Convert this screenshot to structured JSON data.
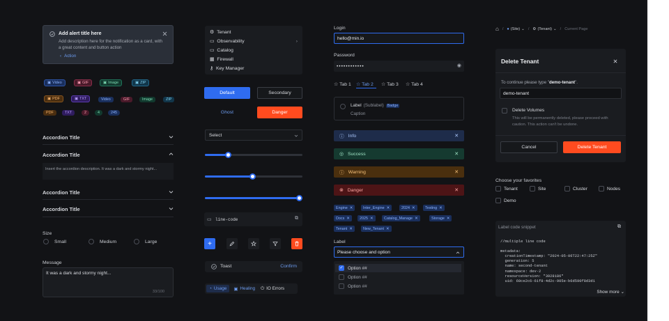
{
  "alert": {
    "title": "Add alert title here",
    "description": "Add description here for the notification as a card, with a great content and button action",
    "action": "Action"
  },
  "badges_row1": [
    "Video",
    "GIF",
    "Image",
    "ZIP"
  ],
  "badges_row2": [
    "PDF",
    "TXT",
    "Video",
    "GIF",
    "Image",
    "ZIP"
  ],
  "badges_row3": [
    "PDF",
    "TXT",
    "2",
    "4",
    "245"
  ],
  "accordion": {
    "items": [
      "Accordion Title",
      "Accordion Title",
      "Accordion Title",
      "Accordion Title"
    ],
    "body": "Insert the accordion description. It was a dark and stormy night..."
  },
  "size": {
    "label": "Size",
    "options": [
      "Small",
      "Medium",
      "Large"
    ]
  },
  "message": {
    "label": "Message",
    "value": "It was a dark and stormy night...",
    "counter": "33/100"
  },
  "menu": {
    "items": [
      "Tenant",
      "Observability",
      "Catalog",
      "Firewall",
      "Key Manager"
    ]
  },
  "buttons": {
    "default": "Default",
    "secondary": "Secondary",
    "ghost": "Ghost",
    "danger": "Danger"
  },
  "select": {
    "value": "Select"
  },
  "sliders": [
    0.24,
    0.49,
    0.97
  ],
  "code_field": {
    "value": "line-code"
  },
  "toast": {
    "text": "Toast",
    "action": "Confirm"
  },
  "tabs_bottom": [
    "Usage",
    "Healing",
    "IO Errors"
  ],
  "login": {
    "label": "Login",
    "value": "hello@min.io",
    "password_label": "Password",
    "password_value": "••••••••••••"
  },
  "tabs": [
    "Tab 1",
    "Tab 2",
    "Tab 3",
    "Tab 4"
  ],
  "checkbox_card": {
    "label": "Label",
    "sublabel": "(Sublabel)",
    "badge": "Badge",
    "caption": "Caption"
  },
  "notifications": [
    {
      "text": "Info",
      "color": "#2f6cf0"
    },
    {
      "text": "Success",
      "color": "#21a36b"
    },
    {
      "text": "Warning",
      "color": "#f0961c"
    },
    {
      "text": "Danger",
      "color": "#e5393b"
    }
  ],
  "chips": [
    "Engine",
    "Inter_Engine",
    "2024",
    "Testing",
    "Docs",
    "2025",
    "Catalog_Manage",
    "Storage",
    "Tenant",
    "New_Tenant"
  ],
  "dropdown": {
    "label": "Label",
    "placeholder": "Please choose and option",
    "options": [
      "Option ##",
      "Option ##",
      "Option ##"
    ]
  },
  "breadcrumb": {
    "items": [
      "(Site)",
      "(Tenant)",
      "Current Page"
    ]
  },
  "modal": {
    "title": "Delete Tenant",
    "instruction_pre": "To continue please type \"",
    "instruction_bold": "demo-tenant",
    "instruction_post": "\".",
    "input_value": "demo-tenant",
    "checkbox_label": "Delete Volumes",
    "warning": "This will be permanently deleted, please proceed with caution. This action can't be undone.",
    "cancel": "Cancel",
    "confirm": "Delete Tenant"
  },
  "favorites": {
    "label": "Choose your favorites",
    "options": [
      "Tenant",
      "Site",
      "Cluster",
      "Nodes",
      "Demo"
    ]
  },
  "snippet": {
    "label": "Label code snippet",
    "lines": [
      "//multiple line code",
      "",
      "metadata:",
      "  creationTimestamp: \"2024-05-06T22:47:25Z\"",
      "  generation: 5",
      "  name: second-tenant",
      "  namespace: dev-2",
      "  resourceVersion: \"3928186\"",
      "  uid: 60ce2c6-61f8-4d2c-905e-b6d590f8d3d1"
    ],
    "show_more": "Show more"
  },
  "colors": {
    "primary": "#2f6cf0",
    "danger": "#ff4b1f",
    "bg": "#121316"
  }
}
